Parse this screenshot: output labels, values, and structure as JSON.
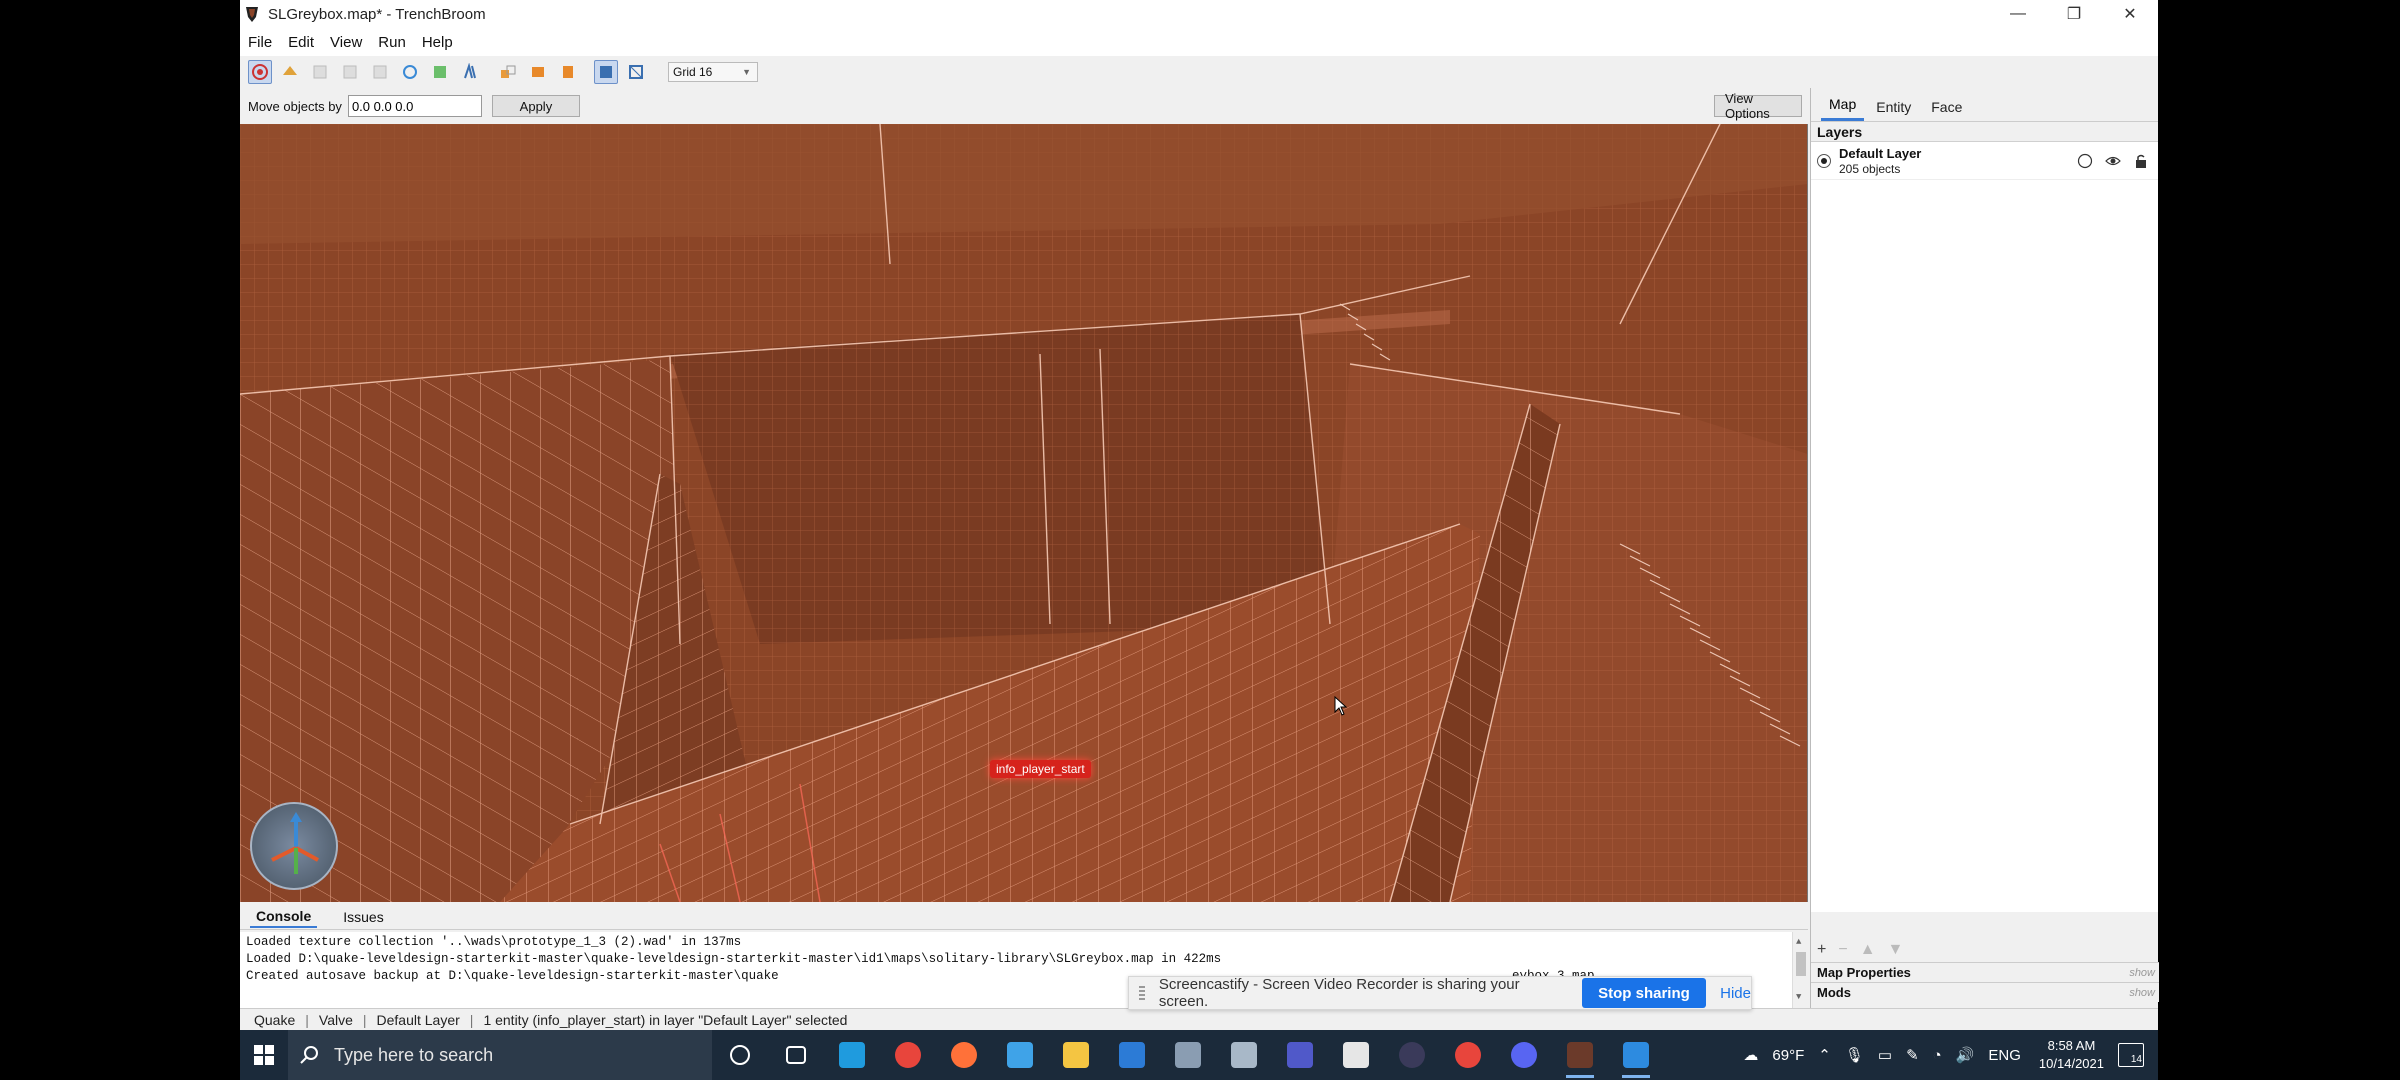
{
  "window": {
    "title": "SLGreybox.map* - TrenchBroom",
    "minimize_glyph": "—",
    "restore_glyph": "❐",
    "close_glyph": "✕"
  },
  "menu": [
    "File",
    "Edit",
    "View",
    "Run",
    "Help"
  ],
  "toolbar": {
    "grid_value": "Grid 16",
    "tools": [
      "brush-tool-icon",
      "entity-tool-icon",
      "vertex-tool-icon",
      "edge-tool-icon",
      "face-tool-icon",
      "rotate-tool-icon",
      "clip-tool-icon",
      "circle-tool-icon",
      "grid-tool-icon",
      "texture-lock-icon",
      "uv-lock-icon",
      "duplicate-icon",
      "flip-horizontal-icon",
      "flip-vertical-icon",
      "selection-mode-icon",
      "snap-mode-icon"
    ]
  },
  "move_bar": {
    "label": "Move objects by",
    "value": "0.0 0.0 0.0",
    "apply": "Apply",
    "view_options": "View Options"
  },
  "viewport": {
    "entity_label": "info_player_start",
    "accent": "#8a4428",
    "grid_color": "#d98a6a"
  },
  "inspector": {
    "tabs": [
      "Map",
      "Entity",
      "Face"
    ],
    "active_tab": "Map",
    "layers_header": "Layers",
    "layer": {
      "name": "Default Layer",
      "count": "205 objects"
    },
    "tools": [
      "+",
      "−",
      "▲",
      "▼"
    ],
    "map_properties": "Map Properties",
    "mods": "Mods",
    "show": "show"
  },
  "console": {
    "tabs": [
      "Console",
      "Issues"
    ],
    "lines": [
      "Loaded texture collection '..\\wads\\prototype_1_3 (2).wad' in 137ms",
      "Loaded D:\\quake-leveldesign-starterkit-master\\quake-leveldesign-starterkit-master\\id1\\maps\\solitary-library\\SLGreybox.map in 422ms",
      "Created autosave backup at D:\\quake-leveldesign-starterkit-master\\quake"
    ],
    "line3_tail": "eybox.3.map"
  },
  "status": {
    "items": [
      "Quake",
      "Valve",
      "Default Layer",
      "1 entity (info_player_start) in layer \"Default Layer\" selected"
    ]
  },
  "share_bar": {
    "message": "Screencastify - Screen Video Recorder is sharing your screen.",
    "stop": "Stop sharing",
    "hide": "Hide"
  },
  "taskbar": {
    "search_placeholder": "Type here to search",
    "apps": [
      {
        "name": "cortana-icon",
        "color": "#1b2a3a"
      },
      {
        "name": "task-view-icon",
        "color": "#1b2a3a"
      },
      {
        "name": "edge-icon",
        "color": "#1f9bde"
      },
      {
        "name": "chrome-icon",
        "color": "#e8453c"
      },
      {
        "name": "firefox-icon",
        "color": "#ff7139"
      },
      {
        "name": "blue-app-icon",
        "color": "#3fa3e8"
      },
      {
        "name": "file-explorer-icon",
        "color": "#f4c542"
      },
      {
        "name": "mail-icon",
        "color": "#2c7bd6"
      },
      {
        "name": "gear-app-icon",
        "color": "#8a9db2"
      },
      {
        "name": "gear-app-2-icon",
        "color": "#a8b8c8"
      },
      {
        "name": "teams-icon",
        "color": "#5059c9"
      },
      {
        "name": "terminal-icon",
        "color": "#e6e6e6"
      },
      {
        "name": "obs-icon",
        "color": "#3a3a5a"
      },
      {
        "name": "chrome-2-icon",
        "color": "#e8453c"
      },
      {
        "name": "discord-icon",
        "color": "#5865f2"
      },
      {
        "name": "trenchbroom-icon",
        "color": "#6b3a2a"
      },
      {
        "name": "photos-icon",
        "color": "#2d8be0"
      }
    ],
    "weather": "69°F",
    "language": "ENG",
    "time": "8:58 AM",
    "date": "10/14/2021",
    "notifications": "14"
  }
}
